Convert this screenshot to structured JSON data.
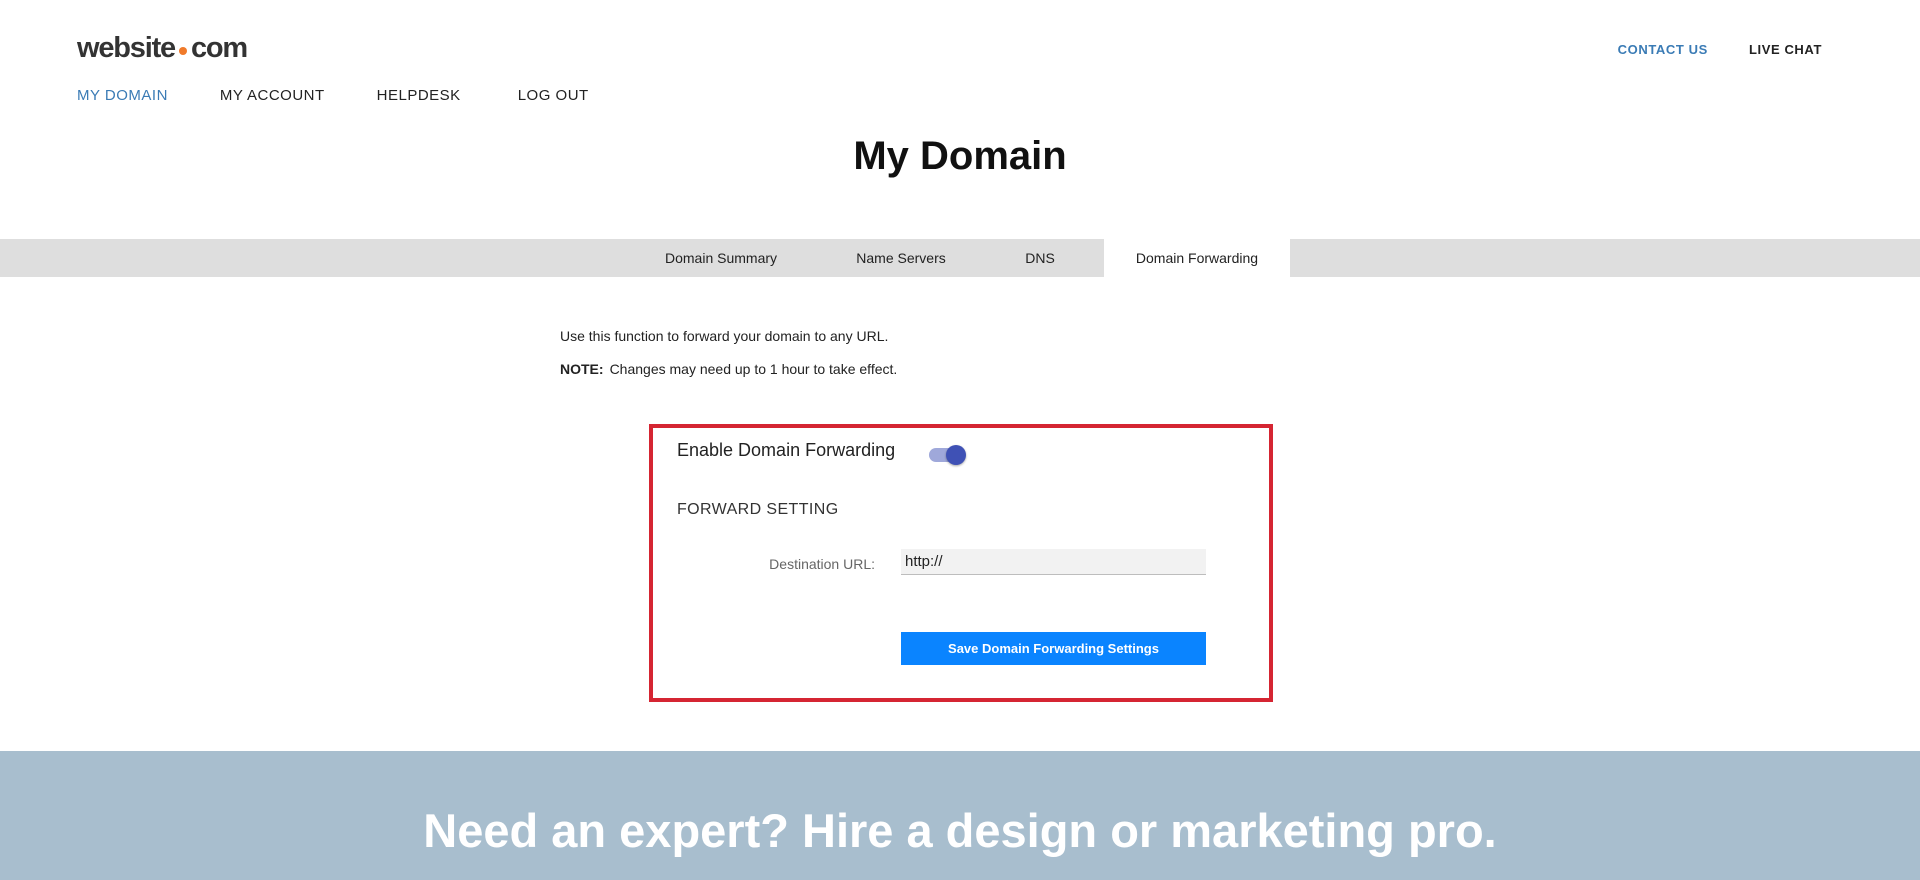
{
  "header": {
    "logo": {
      "prefix": "website",
      "suffix": "com"
    },
    "top_links": {
      "contact": "CONTACT US",
      "chat": "LIVE CHAT"
    },
    "nav": [
      {
        "label": "MY DOMAIN",
        "active": true
      },
      {
        "label": "MY ACCOUNT"
      },
      {
        "label": "HELPDESK"
      },
      {
        "label": "LOG OUT"
      }
    ]
  },
  "page": {
    "title": "My Domain"
  },
  "tabs": [
    {
      "label": "Domain Summary"
    },
    {
      "label": "Name Servers"
    },
    {
      "label": "DNS"
    },
    {
      "label": "Domain Forwarding",
      "active": true
    }
  ],
  "intro": {
    "line1": "Use this function to forward your domain to any URL.",
    "note_label": "NOTE:",
    "note_text": "Changes may need up to 1 hour to take effect."
  },
  "forwarding": {
    "enable_label": "Enable Domain Forwarding",
    "enabled": true,
    "section_heading": "FORWARD SETTING",
    "destination_label": "Destination URL:",
    "destination_value": "http://",
    "save_label": "Save Domain Forwarding Settings"
  },
  "footer": {
    "headline": "Need an expert? Hire a design or marketing pro."
  },
  "colors": {
    "accent": "#3a7bb5",
    "button": "#0a84ff",
    "highlight_border": "#d52532",
    "toggle": "#3f51b5",
    "banner": "#a8bece"
  }
}
